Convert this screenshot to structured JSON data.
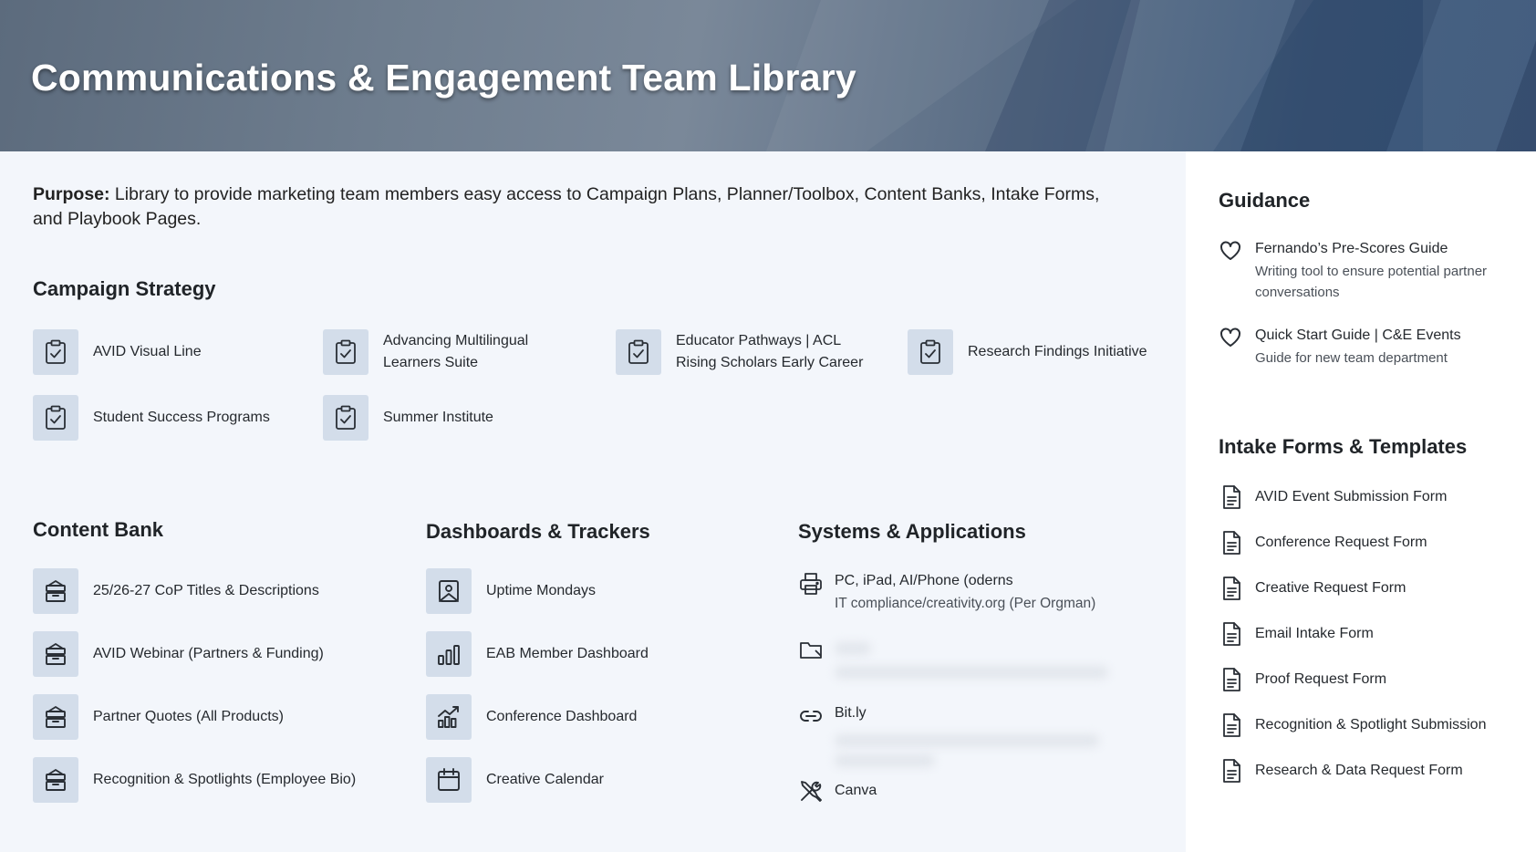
{
  "header": {
    "title": "Communications & Engagement Team Library"
  },
  "purpose": {
    "label": "Purpose:",
    "text": " Library to provide marketing team members easy access to Campaign Plans, Planner/Toolbox, Content Banks, Intake Forms, and Playbook Pages."
  },
  "campaign_strategy": {
    "heading": "Campaign Strategy",
    "items": [
      {
        "label": "AVID Visual Line",
        "icon": "clipboard-check-icon"
      },
      {
        "label": "Advancing Multilingual Learners Suite",
        "icon": "clipboard-check-icon"
      },
      {
        "label": "Educator Pathways | ACL Rising Scholars Early Career",
        "icon": "clipboard-check-icon"
      },
      {
        "label": "Research Findings Initiative",
        "icon": "clipboard-check-icon"
      },
      {
        "label": "Student Success Programs",
        "icon": "clipboard-check-icon"
      },
      {
        "label": "Summer Institute",
        "icon": "clipboard-check-icon"
      }
    ]
  },
  "content_bank": {
    "heading": "Content Bank",
    "items": [
      {
        "label": "25/26-27 CoP Titles & Descriptions",
        "icon": "archive-icon"
      },
      {
        "label": "AVID Webinar (Partners & Funding)",
        "icon": "archive-icon"
      },
      {
        "label": "Partner Quotes (All Products)",
        "icon": "archive-icon"
      },
      {
        "label": "Recognition & Spotlights (Employee Bio)",
        "icon": "archive-icon"
      }
    ]
  },
  "dashboards": {
    "heading": "Dashboards & Trackers",
    "items": [
      {
        "label": "Uptime Mondays",
        "icon": "image-frame-icon"
      },
      {
        "label": "EAB Member Dashboard",
        "icon": "bar-chart-icon"
      },
      {
        "label": "Conference Dashboard",
        "icon": "trend-chart-icon"
      },
      {
        "label": "Creative Calendar",
        "icon": "calendar-icon"
      }
    ]
  },
  "systems": {
    "heading": "Systems & Applications",
    "items": [
      {
        "title": "PC, iPad, AI/Phone (oderns",
        "subtitle": "IT compliance/creativity.org (Per Orgman)",
        "icon": "printer-icon"
      },
      {
        "title": "",
        "subtitle": "",
        "icon": "folder-icon"
      },
      {
        "title": "Bit.ly",
        "subtitle": "",
        "icon": "link-icon"
      },
      {
        "title": "Canva",
        "subtitle": "",
        "icon": "tools-icon"
      }
    ]
  },
  "guidance": {
    "heading": "Guidance",
    "items": [
      {
        "title": "Fernando’s Pre-Scores Guide",
        "subtitle": "Writing tool to ensure potential partner conversations",
        "icon": "heart-icon"
      },
      {
        "title": "Quick Start Guide | C&E Events",
        "subtitle": "Guide for new team department",
        "icon": "heart-icon"
      }
    ]
  },
  "intake_forms": {
    "heading": "Intake Forms & Templates",
    "items": [
      {
        "label": "AVID Event Submission Form",
        "icon": "document-icon"
      },
      {
        "label": "Conference Request Form",
        "icon": "document-icon"
      },
      {
        "label": "Creative Request Form",
        "icon": "document-icon"
      },
      {
        "label": "Email Intake Form",
        "icon": "document-icon"
      },
      {
        "label": "Proof Request Form",
        "icon": "document-icon"
      },
      {
        "label": "Recognition & Spotlight Submission",
        "icon": "document-icon"
      },
      {
        "label": "Research & Data Request Form",
        "icon": "document-icon"
      }
    ]
  }
}
